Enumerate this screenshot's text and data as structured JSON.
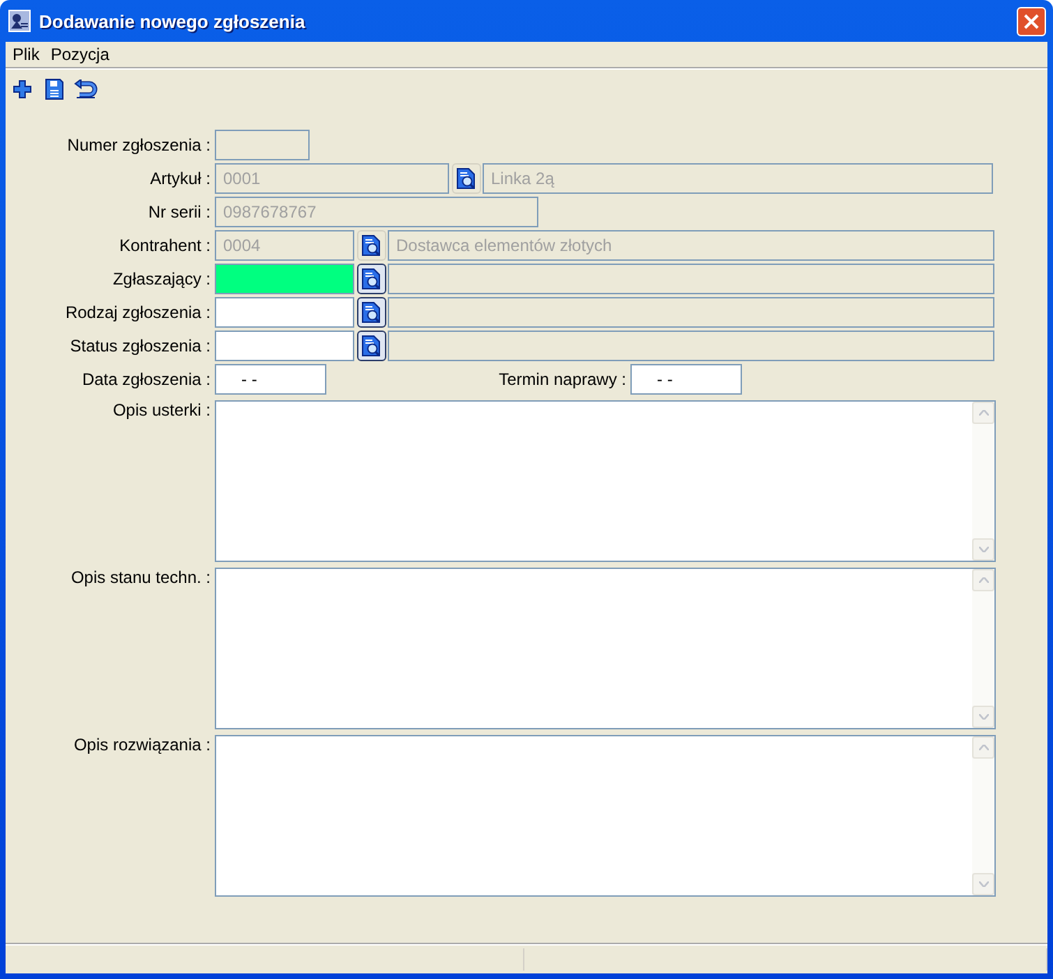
{
  "window": {
    "title": "Dodawanie nowego zgłoszenia"
  },
  "menu": [
    {
      "label": "Plik"
    },
    {
      "label": "Pozycja"
    }
  ],
  "toolbar": [
    {
      "kind": "add"
    },
    {
      "kind": "save"
    },
    {
      "kind": "undo"
    }
  ],
  "rows": [
    {
      "kind": "text",
      "label": "Numer zgłoszenia :",
      "disabled": true
    },
    {
      "kind": "lookup",
      "label": "Artykuł :",
      "code": "0001",
      "name": "Linka 2ą",
      "disabled": true,
      "focused": false
    },
    {
      "kind": "text",
      "label": "Nr serii :",
      "value": "0987678767",
      "disabled": true
    },
    {
      "kind": "lookup",
      "label": "Kontrahent :",
      "code": "0004",
      "name": "Dostawca elementów złotych",
      "disabled": true,
      "focused": false
    },
    {
      "kind": "lookup",
      "label": "Zgłaszający :",
      "disabled": false,
      "focused": true
    },
    {
      "kind": "lookup",
      "label": "Rodzaj zgłoszenia :",
      "disabled": false,
      "focused": false
    },
    {
      "kind": "lookup",
      "label": "Status zgłoszenia :",
      "disabled": false,
      "focused": false
    },
    {
      "kind": "dates",
      "label": "Data zgłoszenia :",
      "value": "- -",
      "second_label": "Termin naprawy :",
      "second_value": "- -"
    }
  ],
  "textareas": [
    {
      "label": "Opis usterki :"
    },
    {
      "label": "Opis stanu techn. :"
    },
    {
      "label": "Opis rozwiązania :"
    }
  ]
}
